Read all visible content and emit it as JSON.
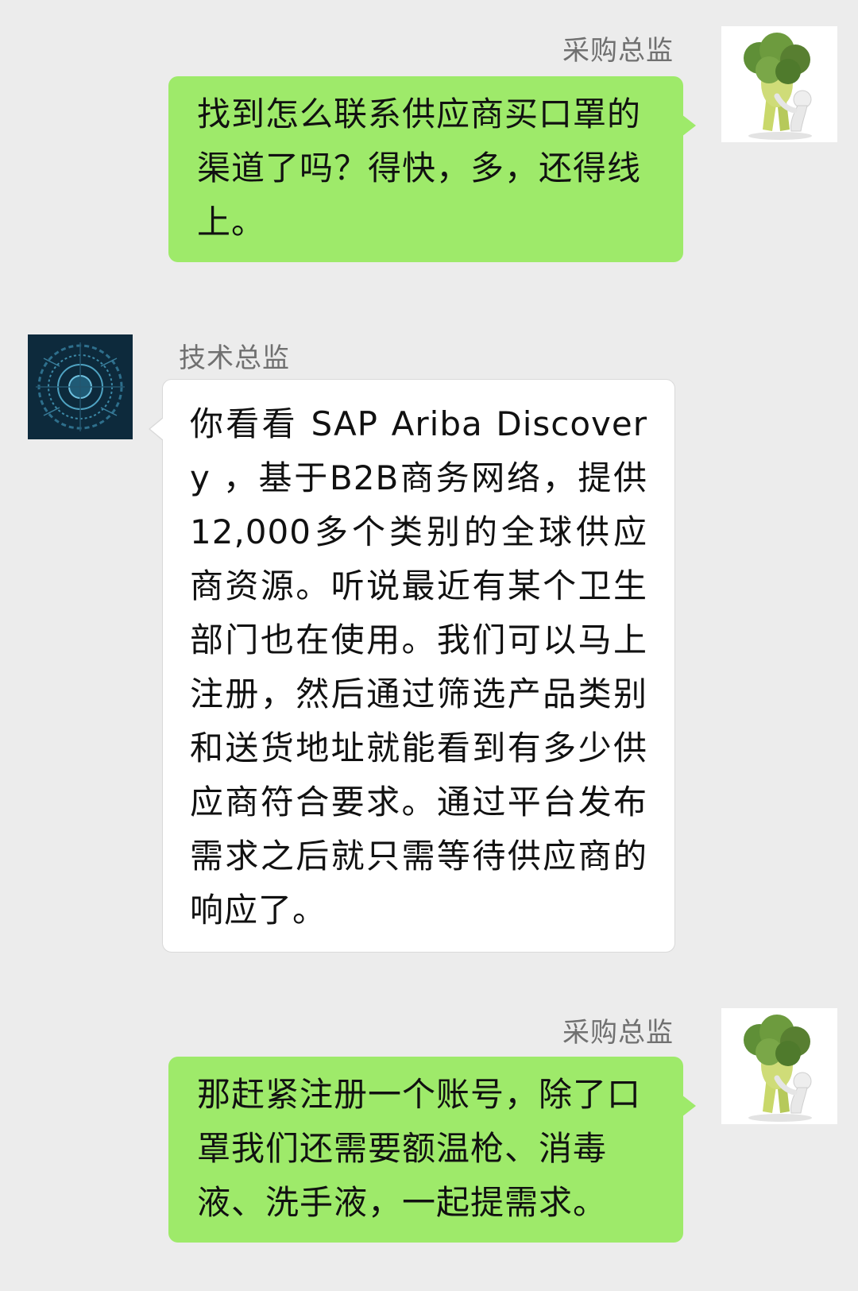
{
  "messages": [
    {
      "sender": "采购总监",
      "direction": "outgoing",
      "avatar_icon": "broccoli-man-icon",
      "text": "找到怎么联系供应商买口罩的渠道了吗？得快，多，还得线上。"
    },
    {
      "sender": "技术总监",
      "direction": "incoming",
      "avatar_icon": "digital-globe-icon",
      "text": "你看看 SAP Ariba Discovery ，基于B2B商务网络，提供12,000多个类别的全球供应商资源。听说最近有某个卫生部门也在使用。我们可以马上注册，然后通过筛选产品类别和送货地址就能看到有多少供应商符合要求。通过平台发布需求之后就只需等待供应商的响应了。"
    },
    {
      "sender": "采购总监",
      "direction": "outgoing",
      "avatar_icon": "broccoli-man-icon",
      "text": "那赶紧注册一个账号，除了口罩我们还需要额温枪、消毒液、洗手液，一起提需求。"
    }
  ],
  "colors": {
    "background": "#ececec",
    "outgoing_bubble": "#9eea6a",
    "incoming_bubble": "#ffffff",
    "sender_name": "#707070",
    "message_text": "#111111"
  }
}
